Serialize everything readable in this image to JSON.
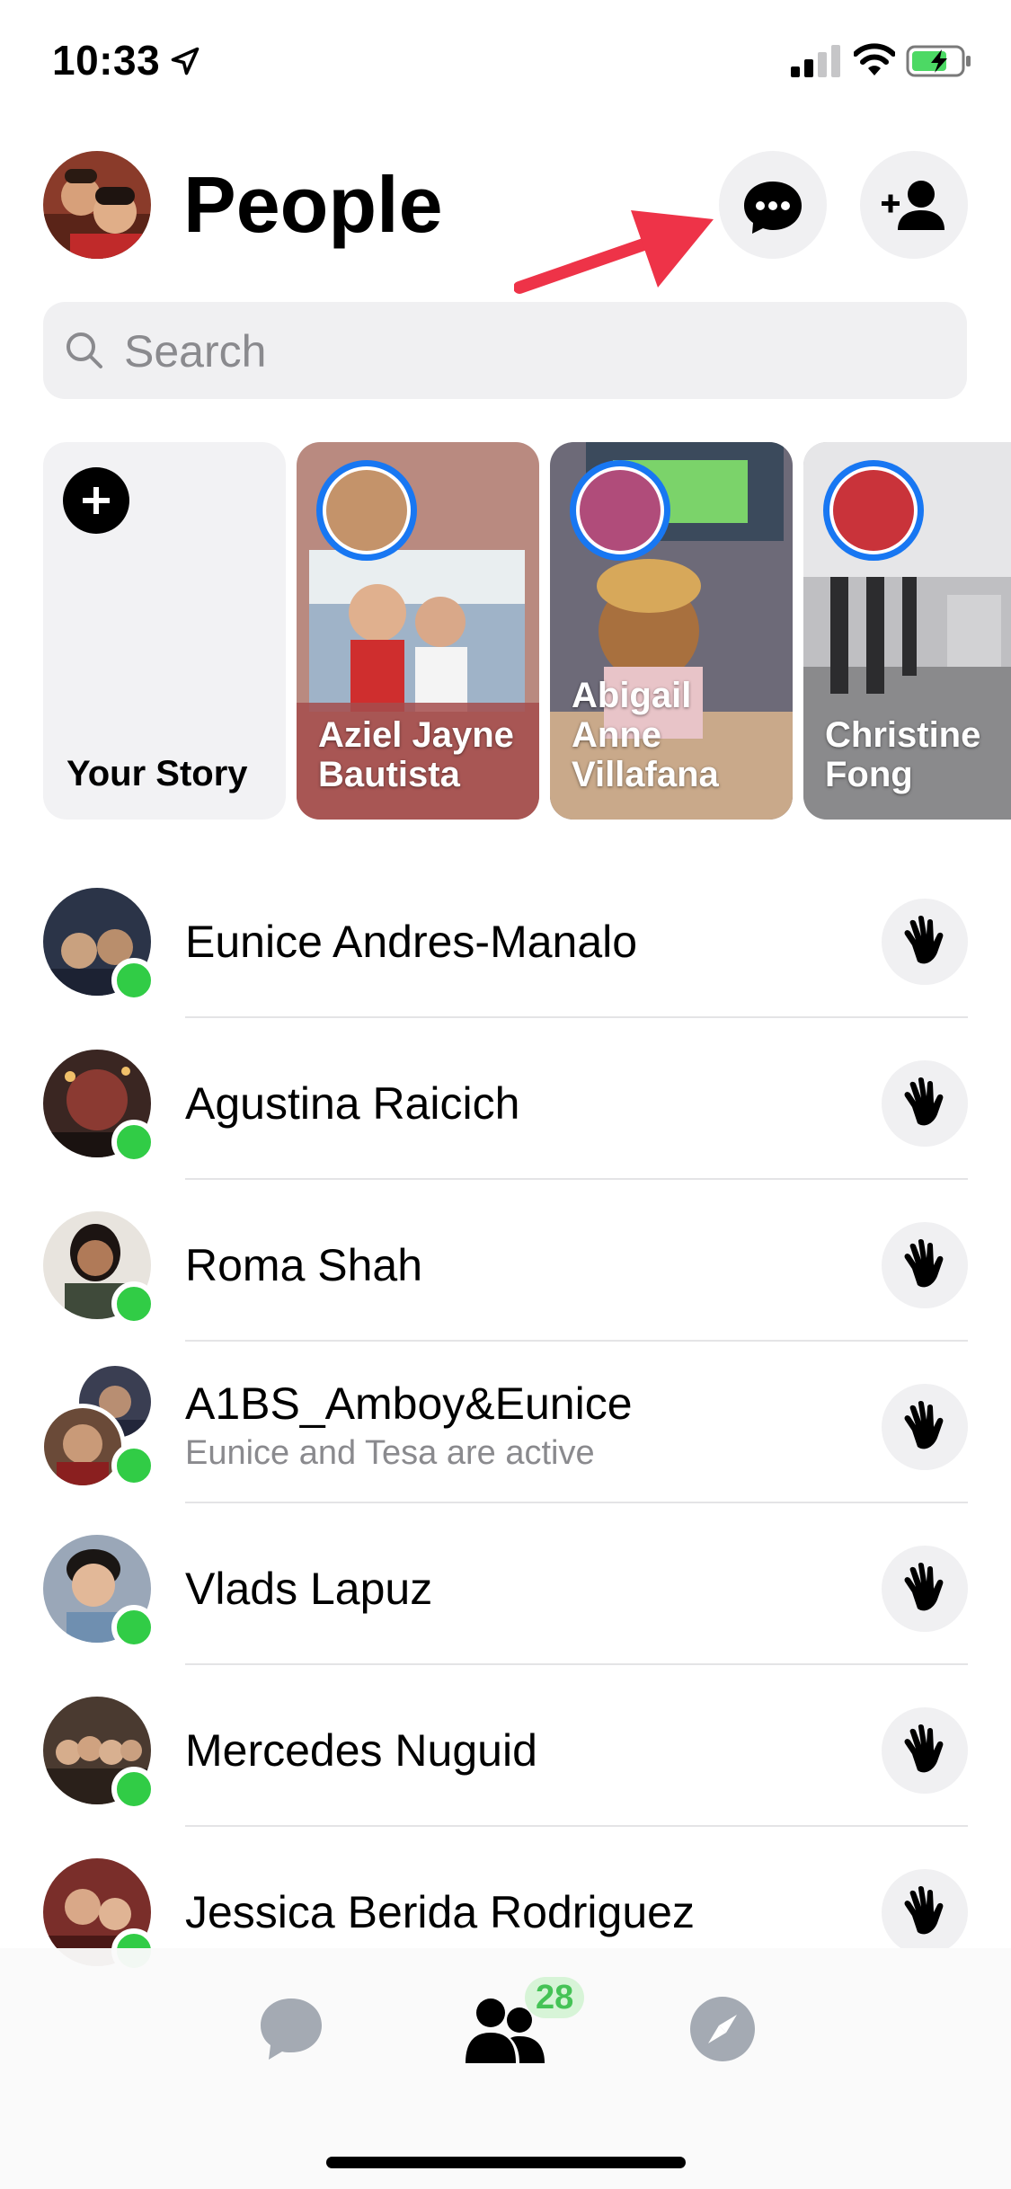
{
  "status_bar": {
    "time": "10:33"
  },
  "header": {
    "title": "People"
  },
  "search": {
    "placeholder": "Search"
  },
  "stories": {
    "your_story_label": "Your Story",
    "items": [
      {
        "name": "Aziel Jayne Bautista"
      },
      {
        "name": "Abigail Anne Villafana"
      },
      {
        "name": "Christine Fong"
      }
    ]
  },
  "people": [
    {
      "name": "Eunice Andres-Manalo",
      "subtitle": ""
    },
    {
      "name": "Agustina Raicich",
      "subtitle": ""
    },
    {
      "name": "Roma Shah",
      "subtitle": ""
    },
    {
      "name": "A1BS_Amboy&Eunice",
      "subtitle": "Eunice and Tesa are active"
    },
    {
      "name": "Vlads Lapuz",
      "subtitle": ""
    },
    {
      "name": "Mercedes Nuguid",
      "subtitle": ""
    },
    {
      "name": "Jessica Berida Rodriguez",
      "subtitle": ""
    }
  ],
  "tab_bar": {
    "people_badge": "28"
  },
  "colors": {
    "accent": "#1877f2",
    "online": "#31cc46",
    "badge_bg": "#d7f4d7",
    "badge_text": "#45c356",
    "arrow": "#ee3348"
  },
  "icons": [
    "location-arrow-icon",
    "signal-icon",
    "wifi-icon",
    "battery-icon",
    "chat-bubble-icon",
    "add-person-icon",
    "search-icon",
    "plus-icon",
    "wave-icon",
    "chats-tab-icon",
    "people-tab-icon",
    "discover-tab-icon"
  ]
}
